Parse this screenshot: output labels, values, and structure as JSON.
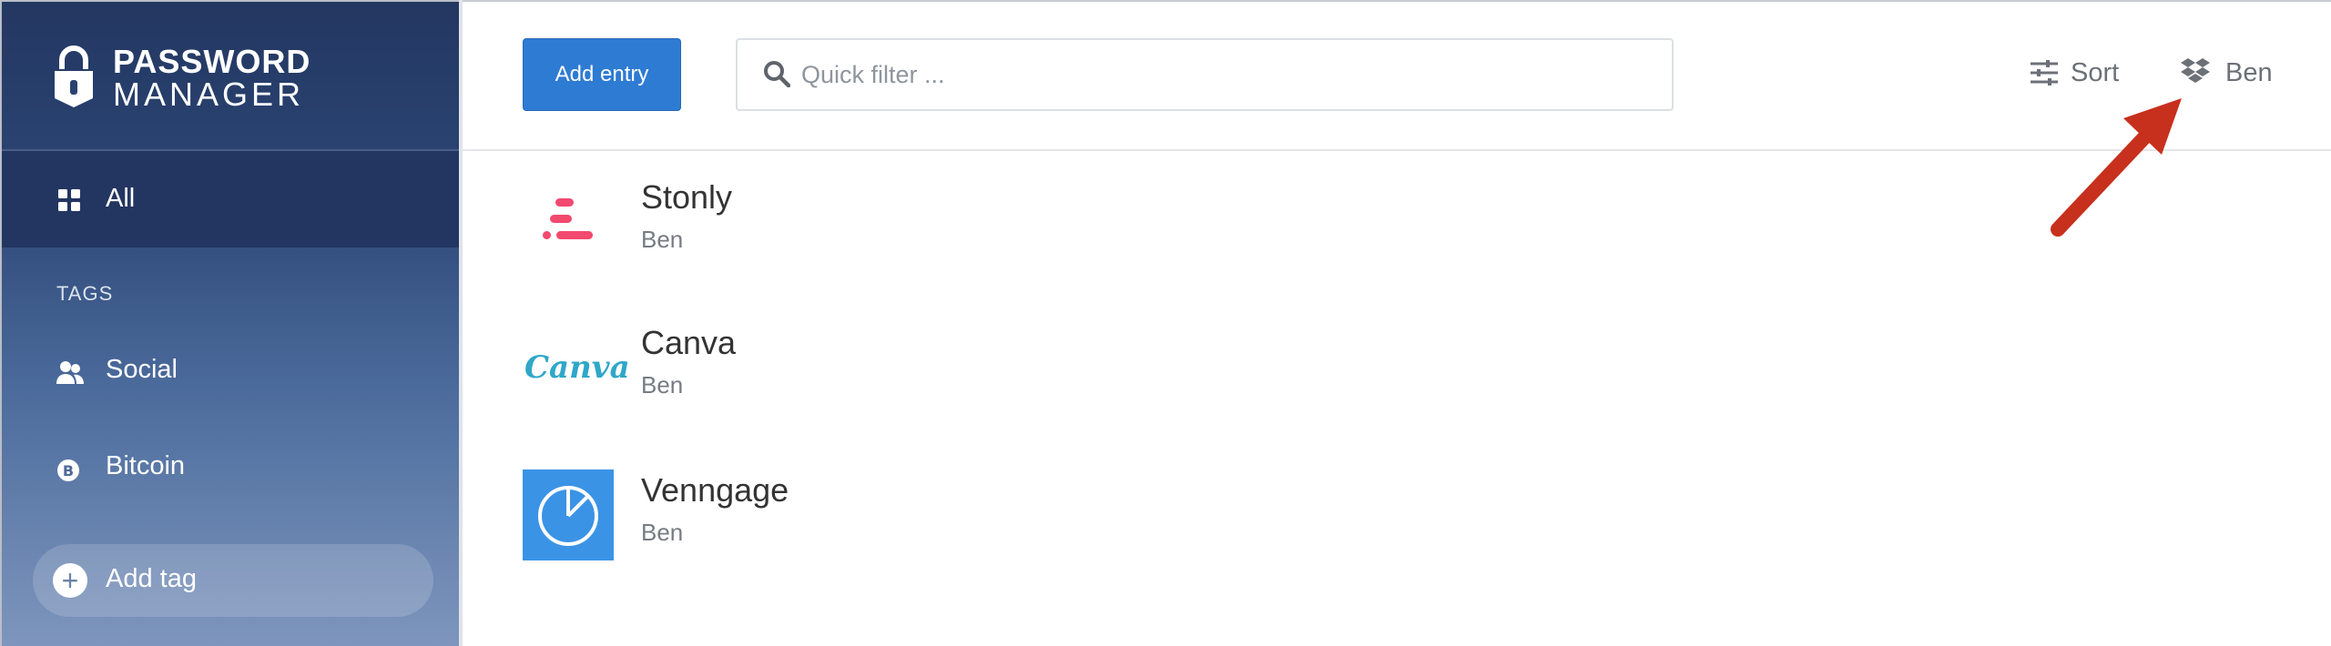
{
  "brand": {
    "line1": "PASSWORD",
    "line2": "MANAGER"
  },
  "sidebar": {
    "all_label": "All",
    "tags_heading": "TAGS",
    "tags": [
      {
        "label": "Social",
        "icon": "people-icon"
      },
      {
        "label": "Bitcoin",
        "icon": "bitcoin-icon"
      }
    ],
    "add_tag_label": "Add tag"
  },
  "toolbar": {
    "add_entry_label": "Add entry",
    "search_placeholder": "Quick filter ...",
    "sort_label": "Sort",
    "account_label": "Ben",
    "account_icon": "dropbox-icon"
  },
  "entries": [
    {
      "title": "Stonly",
      "user": "Ben",
      "icon": "stonly-logo"
    },
    {
      "title": "Canva",
      "user": "Ben",
      "icon": "canva-logo",
      "logo_text": "Canva"
    },
    {
      "title": "Venngage",
      "user": "Ben",
      "icon": "venngage-logo"
    }
  ],
  "colors": {
    "primary_button": "#2e7bd3",
    "sidebar_top": "#233761",
    "sidebar_bottom": "#7e96bd",
    "stonly_pink": "#f2496e",
    "venngage_blue": "#3b93e6",
    "annotation_arrow": "#c7301d"
  }
}
